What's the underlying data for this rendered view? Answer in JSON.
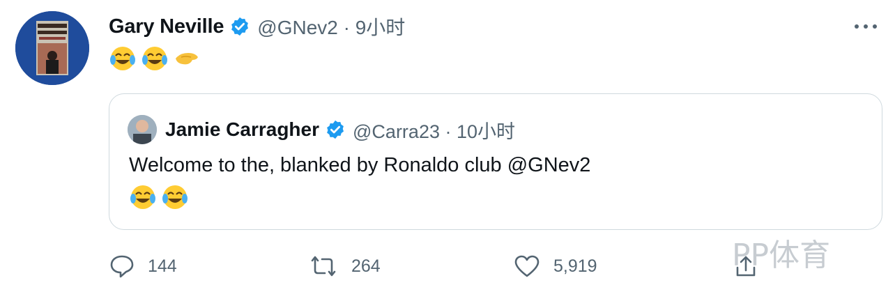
{
  "tweet": {
    "author_name": "Gary Neville",
    "handle_time": "@GNev2 · 9小时",
    "emoji_line": "😂😂🫳",
    "menu_icon": "more-horizontal-icon"
  },
  "quoted_tweet": {
    "author_name": "Jamie Carragher",
    "handle_time": "@Carra23 · 10小时",
    "text": "Welcome to the, blanked by Ronaldo club @GNev2",
    "emoji_line": "😂😂"
  },
  "actions": {
    "reply_count": "144",
    "retweet_count": "264",
    "like_count": "5,919"
  },
  "watermark": {
    "text": "PP体育"
  },
  "colors": {
    "verified_blue": "#1d9bf0",
    "text_primary": "#0f1419",
    "text_secondary": "#536471",
    "border": "#cfd9de"
  }
}
